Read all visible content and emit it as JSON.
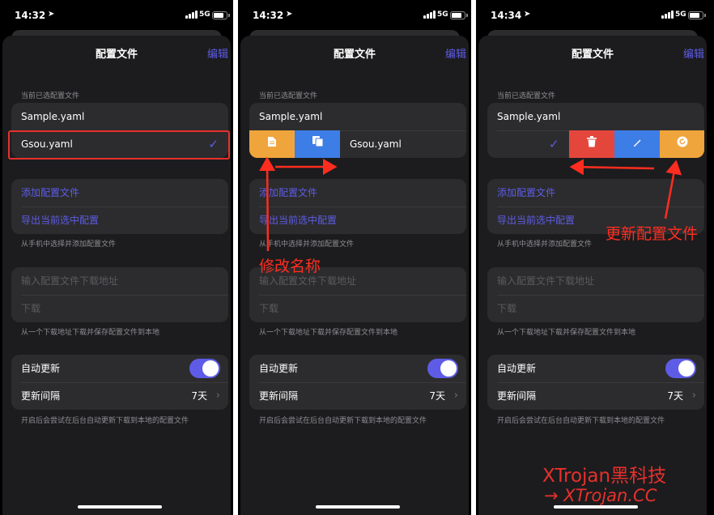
{
  "screens": [
    {
      "time": "14:32",
      "network": "5G"
    },
    {
      "time": "14:32",
      "network": "5G"
    },
    {
      "time": "14:34",
      "network": "5G"
    }
  ],
  "nav": {
    "title": "配置文件",
    "edit": "编辑"
  },
  "current_section": {
    "header": "当前已选配置文件",
    "items": [
      "Sample.yaml",
      "Gsou.yaml"
    ],
    "selected": "Gsou.yaml"
  },
  "add_section": {
    "add_label": "添加配置文件",
    "export_label": "导出当前选中配置",
    "footer": "从手机中选择并添加配置文件"
  },
  "download_section": {
    "url_placeholder": "输入配置文件下载地址",
    "download_label": "下载",
    "footer": "从一个下载地址下载并保存配置文件到本地"
  },
  "auto_update_section": {
    "auto_update_label": "自动更新",
    "auto_update_on": true,
    "interval_label": "更新间隔",
    "interval_value": "7天",
    "footer": "开启后会尝试在后台自动更新下载到本地的配置文件"
  },
  "swipe_actions": {
    "screen2": [
      {
        "icon": "document-icon",
        "color": "#f0a43c"
      },
      {
        "icon": "copy-icon",
        "color": "#3d7de6"
      }
    ],
    "screen3": [
      {
        "icon": "trash-icon",
        "color": "#e5463c"
      },
      {
        "icon": "pencil-icon",
        "color": "#3d7de6"
      },
      {
        "icon": "refresh-icon",
        "color": "#f0a43c"
      }
    ]
  },
  "annotations": {
    "rename": "修改名称",
    "update": "更新配置文件"
  },
  "watermark": {
    "line1": "XTrojan黑科技",
    "line2": "→ XTrojan.CC"
  },
  "colors": {
    "accent": "#5e5ce6",
    "annotation": "#ff2d1f"
  }
}
